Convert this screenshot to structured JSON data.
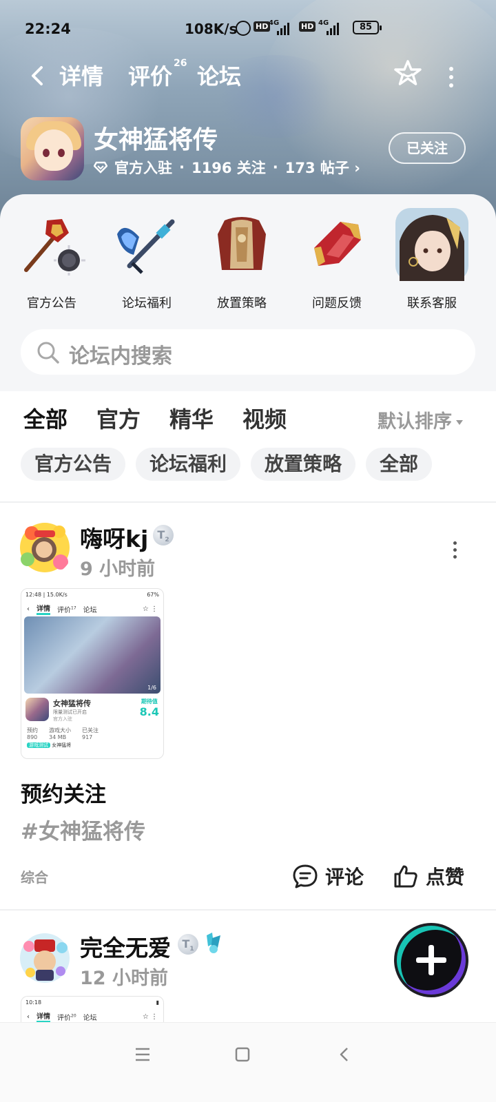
{
  "status_bar": {
    "time": "22:24",
    "net_speed": "108K/s",
    "hd1": "HD",
    "hd2": "HD",
    "sig1": "4G",
    "sig2": "4G",
    "battery": "85"
  },
  "nav": {
    "tabs": [
      {
        "label": "详情"
      },
      {
        "label": "评价",
        "badge": "26"
      },
      {
        "label": "论坛"
      }
    ],
    "active_tab": "论坛"
  },
  "game": {
    "title": "女神猛将传",
    "verified": "官方入驻",
    "followers": "1196 关注",
    "posts": "173 帖子",
    "follow_button": "已关注",
    "sep": "·"
  },
  "quick_links": [
    {
      "label": "官方公告",
      "icon": "mace-icon"
    },
    {
      "label": "论坛福利",
      "icon": "halberd-icon"
    },
    {
      "label": "放置策略",
      "icon": "armor-icon"
    },
    {
      "label": "问题反馈",
      "icon": "gauntlet-icon"
    },
    {
      "label": "联系客服",
      "icon": "support-avatar-icon"
    }
  ],
  "search": {
    "placeholder": "论坛内搜索"
  },
  "filter_tabs": [
    {
      "label": "全部"
    },
    {
      "label": "官方"
    },
    {
      "label": "精华"
    },
    {
      "label": "视频"
    }
  ],
  "sort_label": "默认排序",
  "chips": [
    {
      "label": "官方公告"
    },
    {
      "label": "论坛福利"
    },
    {
      "label": "放置策略"
    },
    {
      "label": "全部"
    }
  ],
  "posts": [
    {
      "user": "嗨呀kj",
      "badge": "T",
      "badge_level": "2",
      "time": "9 小时前",
      "shot": {
        "status": "12:48 | 15.0K/s",
        "battery": "67%",
        "tab1": "详情",
        "tab2": "评价",
        "tab2_badge": "17",
        "tab3": "论坛",
        "page": "1/6",
        "game": "女神猛将传",
        "sub": "限量测试已开启",
        "verified": "官方入驻",
        "rating_label": "期待值",
        "rating": "8.4",
        "stat1_label": "预约",
        "stat1": "890",
        "stat2_label": "游戏大小",
        "stat2": "34 MB",
        "stat3_label": "已关注",
        "stat3": "917",
        "footer_tag": "游戏测试",
        "footer_text": "女神猛将"
      },
      "title": "预约关注",
      "tag": "#女神猛将传",
      "category": "综合",
      "comment": "评论",
      "like": "点赞"
    },
    {
      "user": "完全无爱",
      "badge": "T",
      "badge_level": "1",
      "time": "12 小时前",
      "shot": {
        "status": "10:18",
        "tab1": "详情",
        "tab2": "评价",
        "tab2_badge": "20",
        "tab3": "论坛"
      }
    }
  ],
  "colors": {
    "accent": "#27d3c3",
    "fab_purple": "#6a3ad8"
  }
}
